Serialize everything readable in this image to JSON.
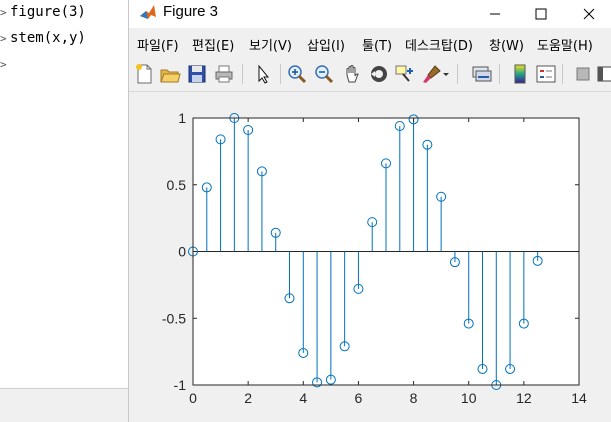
{
  "command_window": {
    "lines": [
      {
        "prompt": ">",
        "text": "figure(3)"
      },
      {
        "prompt": ">",
        "text": "stem(x,y)"
      },
      {
        "prompt": ">",
        "text": ""
      }
    ]
  },
  "figure": {
    "title": "Figure 3",
    "menus": [
      "파일(F)",
      "편집(E)",
      "보기(V)",
      "삽입(I)",
      "툴(T)",
      "데스크탑(D)",
      "창(W)",
      "도움말(H)"
    ],
    "toolbar_icons": [
      "new-figure-icon",
      "open-file-icon",
      "save-icon",
      "print-icon",
      "pointer-icon",
      "zoom-in-icon",
      "zoom-out-icon",
      "pan-icon",
      "rotate-3d-icon",
      "data-cursor-icon",
      "brush-icon",
      "brush-dropdown-icon",
      "link-plot-icon",
      "colorbar-icon",
      "legend-icon",
      "hide-tools-icon",
      "show-tools-icon"
    ]
  },
  "colors": {
    "stem": "#0072bd",
    "axes_bg": "#ffffff",
    "axes_line": "#262626",
    "window_bg": "#f0f0f0"
  },
  "chart_data": {
    "type": "stem",
    "x": [
      0,
      0.5,
      1,
      1.5,
      2,
      2.5,
      3,
      3.5,
      4,
      4.5,
      5,
      5.5,
      6,
      6.5,
      7,
      7.5,
      8,
      8.5,
      9,
      9.5,
      10,
      10.5,
      11,
      11.5,
      12,
      12.5
    ],
    "y": [
      0,
      0.48,
      0.84,
      1.0,
      0.91,
      0.6,
      0.14,
      -0.35,
      -0.76,
      -0.98,
      -0.96,
      -0.71,
      -0.28,
      0.22,
      0.66,
      0.94,
      0.99,
      0.8,
      0.41,
      -0.08,
      -0.54,
      -0.88,
      -1.0,
      -0.88,
      -0.54,
      -0.07
    ],
    "xlim": [
      0,
      14
    ],
    "ylim": [
      -1,
      1
    ],
    "xticks": [
      "0",
      "2",
      "4",
      "6",
      "8",
      "10",
      "12",
      "14"
    ],
    "yticks": [
      "1",
      "0.5",
      "0",
      "-0.5",
      "-1"
    ],
    "xlabel": "",
    "ylabel": "",
    "title": "",
    "grid": false,
    "baseline": 0
  }
}
